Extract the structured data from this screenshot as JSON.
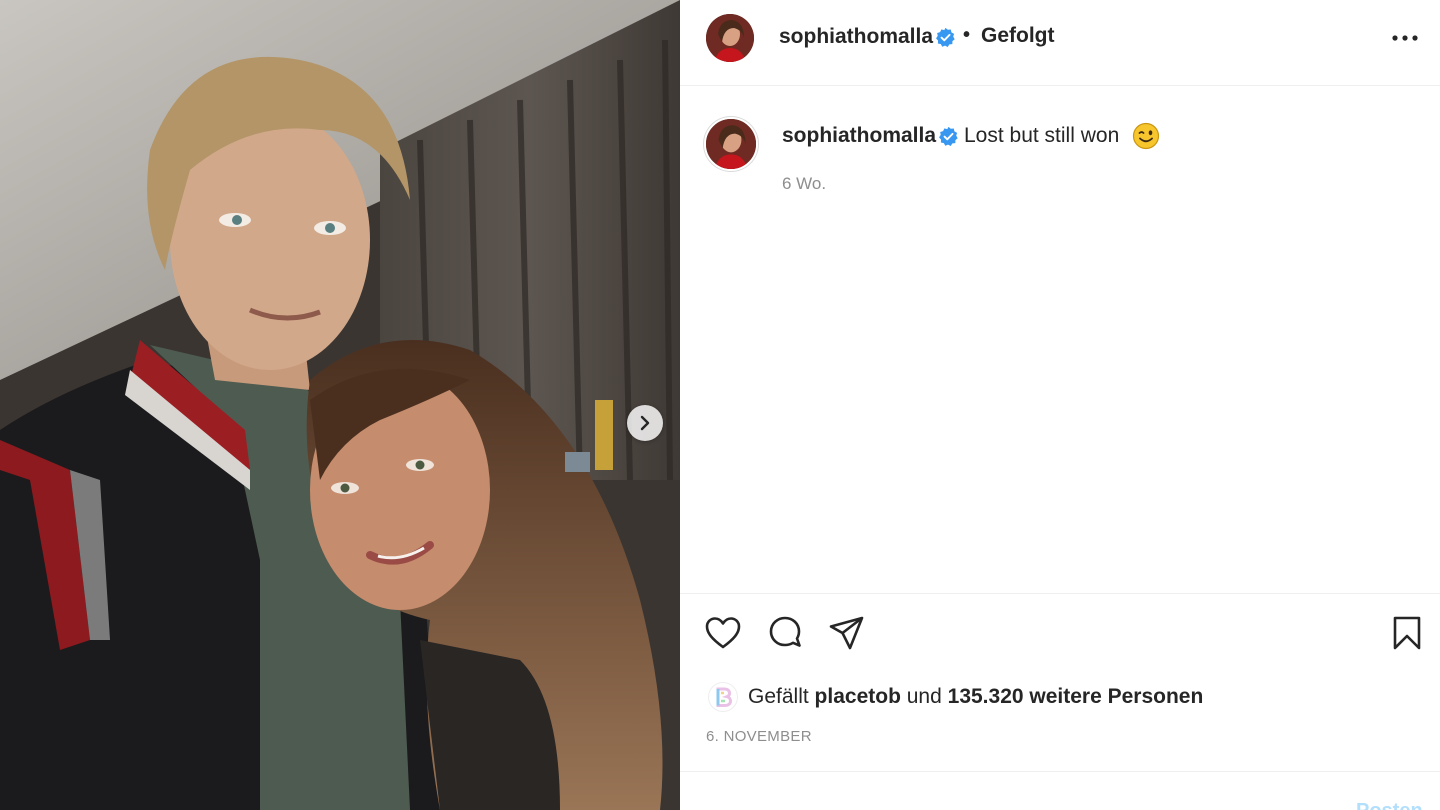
{
  "header": {
    "username": "sophiathomalla",
    "separator": "•",
    "follow_status": "Gefolgt"
  },
  "caption": {
    "username": "sophiathomalla",
    "text": "Lost but still won",
    "emoji": "winking-face",
    "time_ago": "6 Wo."
  },
  "likes": {
    "prefix": "Gefällt",
    "user": "placetob",
    "connector": "und",
    "count_text": "135.320 weitere Personen"
  },
  "date": "6. NOVEMBER",
  "comment_box": {
    "post_label": "Posten"
  },
  "icons": {
    "verified": "verified-badge-icon",
    "more": "more-options-icon",
    "like": "heart-icon",
    "comment": "comment-icon",
    "share": "paper-plane-icon",
    "save": "bookmark-icon",
    "next": "chevron-right-icon"
  },
  "colors": {
    "verified_blue": "#3897f0",
    "text_primary": "#262626",
    "text_secondary": "#8e8e8e",
    "post_button_disabled": "#b2dffc"
  }
}
